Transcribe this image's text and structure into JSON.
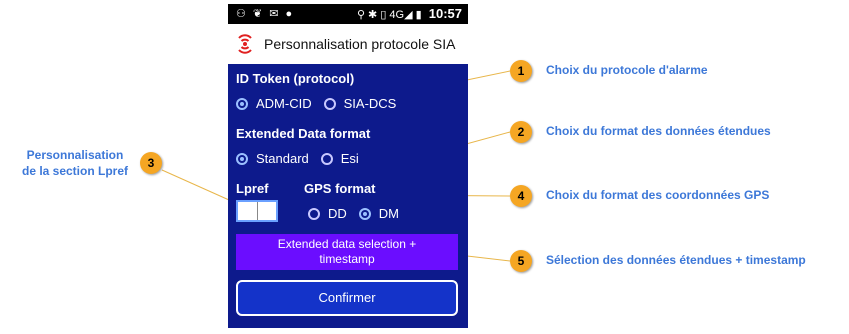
{
  "statusbar": {
    "left_icons": "⚇ ❦ ✉ ●",
    "right_icons": "⚲ ✱ ▯ 4G◢ ▮",
    "time": "10:57"
  },
  "appbar": {
    "logo_icon": "signal-icon",
    "title": "Personnalisation protocole SIA"
  },
  "form": {
    "id_token_title": "ID Token (protocol)",
    "id_token_options": [
      "ADM-CID",
      "SIA-DCS"
    ],
    "id_token_selected": "ADM-CID",
    "ext_format_title": "Extended Data format",
    "ext_format_options": [
      "Standard",
      "Esi"
    ],
    "ext_format_selected": "Standard",
    "lpref_title": "Lpref",
    "lpref_values": [
      "",
      ""
    ],
    "gps_title": "GPS format",
    "gps_options": [
      "DD",
      "DM"
    ],
    "gps_selected": "DM",
    "ext_selection_button_line1": "Extended data selection +",
    "ext_selection_button_line2": "timestamp",
    "confirm_button": "Confirmer"
  },
  "callouts": [
    {
      "number": "1",
      "label": "Choix du protocole d'alarme"
    },
    {
      "number": "2",
      "label": "Choix du format des données étendues"
    },
    {
      "number": "3",
      "label_line1": "Personnalisation",
      "label_line2": "de la section Lpref"
    },
    {
      "number": "4",
      "label": "Choix du format des coordonnées GPS"
    },
    {
      "number": "5",
      "label": "Sélection des données étendues + timestamp"
    }
  ],
  "colors": {
    "screen_bg": "#0d1a8c",
    "callout_badge": "#f5a623",
    "callout_text": "#3d78d8",
    "ext_button": "#6b0dff",
    "confirm_button": "#1433c9"
  }
}
